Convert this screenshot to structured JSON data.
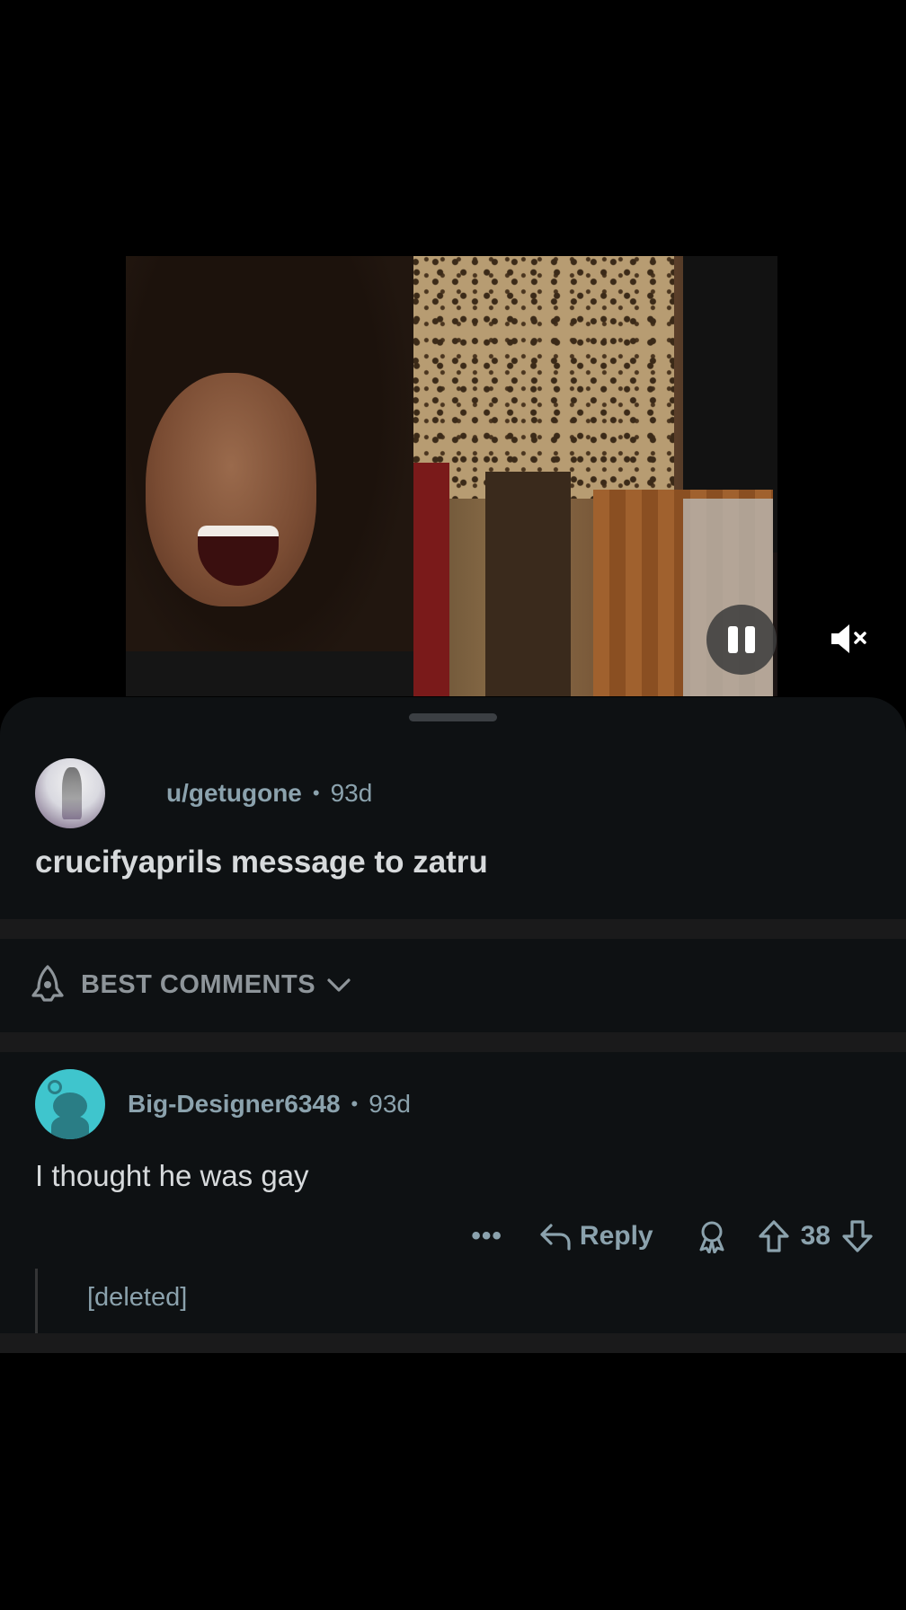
{
  "post": {
    "username": "u/getugone",
    "separator": "•",
    "age": "93d",
    "title": "crucifyaprils message to zatru"
  },
  "sort": {
    "label": "BEST COMMENTS",
    "icon": "rocket-icon"
  },
  "comment": {
    "username": "Big-Designer6348",
    "separator": "•",
    "age": "93d",
    "body": "I thought he was gay",
    "more_label": "•••",
    "reply_label": "Reply",
    "votes": "38"
  },
  "reply": {
    "text": "[deleted]"
  },
  "colors": {
    "background": "#000000",
    "sheet": "#0e1113",
    "meta_text": "#8ba2ad",
    "primary_text": "#d7dadc",
    "snoo_avatar": "#3fc5cd"
  }
}
